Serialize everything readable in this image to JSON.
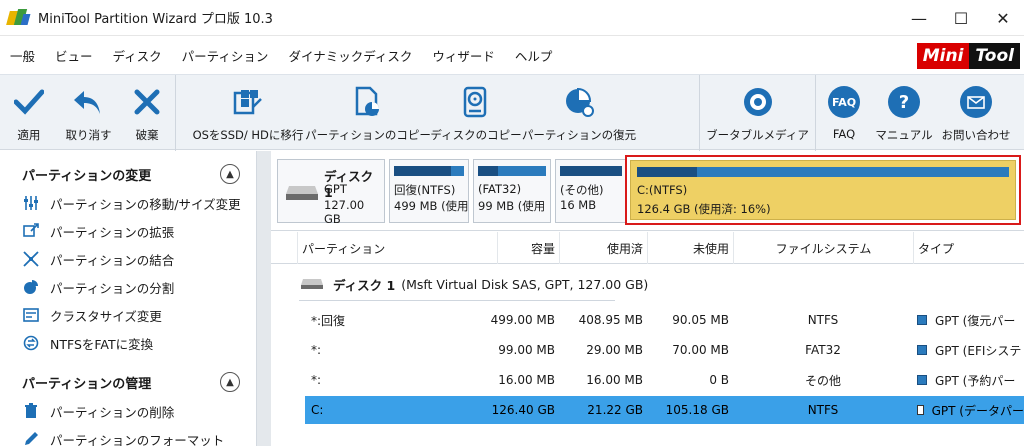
{
  "window": {
    "title": "MiniTool Partition Wizard プロ版 10.3",
    "minimize": "—",
    "maximize": "☐",
    "close": "✕"
  },
  "menu": [
    "一般",
    "ビュー",
    "ディスク",
    "パーティション",
    "ダイナミックディスク",
    "ウィザード",
    "ヘルプ"
  ],
  "brand": {
    "part1": "Mini",
    "part2": "Tool"
  },
  "toolbar": {
    "apply": "適用",
    "undo": "取り消す",
    "discard": "破棄",
    "migrate": "OSをSSD/ HDに移行",
    "copy_partition": "パーティションのコピー",
    "copy_disk": "ディスクのコピー",
    "recover_partition": "パーティションの復元",
    "bootable_media": "ブータブルメディア",
    "faq": "FAQ",
    "faq_icon_text": "FAQ",
    "manual": "マニュアル",
    "contact": "お問い合わせ"
  },
  "left_panel": {
    "section1": {
      "title": "パーティションの変更",
      "items": [
        "パーティションの移動/サイズ変更",
        "パーティションの拡張",
        "パーティションの結合",
        "パーティションの分割",
        "クラスタサイズ変更",
        "NTFSをFATに変換"
      ]
    },
    "section2": {
      "title": "パーティションの管理",
      "items": [
        "パーティションの削除",
        "パーティションのフォーマット"
      ]
    }
  },
  "disk_map": {
    "disk_name": "ディスク 1",
    "disk_style": "GPT",
    "disk_size": "127.00 GB",
    "partitions": [
      {
        "line1": "回復(NTFS)",
        "line2": "499 MB (使用",
        "used_fraction": 0.82
      },
      {
        "line1": "(FAT32)",
        "line2": "99 MB (使用",
        "used_fraction": 0.29
      },
      {
        "line1": "(その他)",
        "line2": "16 MB",
        "used_fraction": 1.0
      }
    ],
    "selected": {
      "line1": "C:(NTFS)",
      "line2": "126.4 GB (使用済: 16%)",
      "used_fraction": 0.16
    }
  },
  "table": {
    "headers": [
      "パーティション",
      "容量",
      "使用済",
      "未使用",
      "ファイルシステム",
      "タイプ"
    ],
    "disk_row": {
      "name": "ディスク 1",
      "desc": "(Msft Virtual Disk SAS, GPT, 127.00 GB)"
    },
    "rows": [
      {
        "partition": "*:回復",
        "capacity": "499.00 MB",
        "used": "408.95 MB",
        "unused": "90.05 MB",
        "fs": "NTFS",
        "type": "GPT (復元パー"
      },
      {
        "partition": "*:",
        "capacity": "99.00 MB",
        "used": "29.00 MB",
        "unused": "70.00 MB",
        "fs": "FAT32",
        "type": "GPT (EFIシステ"
      },
      {
        "partition": "*:",
        "capacity": "16.00 MB",
        "used": "16.00 MB",
        "unused": "0 B",
        "fs": "その他",
        "type": "GPT (予約パー"
      },
      {
        "partition": "C:",
        "capacity": "126.40 GB",
        "used": "21.22 GB",
        "unused": "105.18 GB",
        "fs": "NTFS",
        "type": "GPT (データパー"
      }
    ]
  },
  "colors": {
    "accent": "#1e6fb5",
    "selected_row": "#3aa0e8",
    "selected_partition": "#eed064",
    "highlight_border": "#d91a1a"
  }
}
